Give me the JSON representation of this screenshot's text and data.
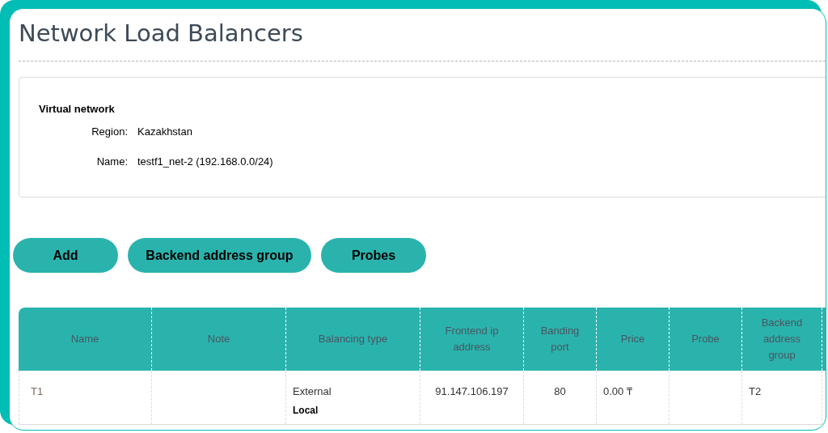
{
  "page": {
    "title": "Network Load Balancers"
  },
  "virtual_network": {
    "heading": "Virtual network",
    "fields": [
      {
        "label": "Region:",
        "value": "Kazakhstan"
      },
      {
        "label": "Name:",
        "value": "testf1_net-2 (192.168.0.0/24)"
      }
    ]
  },
  "buttons": [
    "Add",
    "Backend address group",
    "Probes"
  ],
  "table": {
    "columns": [
      "Name",
      "Note",
      "Balancing type",
      "Frontend ip address",
      "Banding port",
      "Price",
      "Probe",
      "Backend address group"
    ],
    "rows": [
      {
        "name": "T1",
        "balancing_type": {
          "type": "External",
          "scope": "Local"
        },
        "frontend_ip": "91.147.106.197",
        "banding_port": "80",
        "price": "0.00 ₸",
        "backend_address_group": "T2"
      }
    ]
  }
}
